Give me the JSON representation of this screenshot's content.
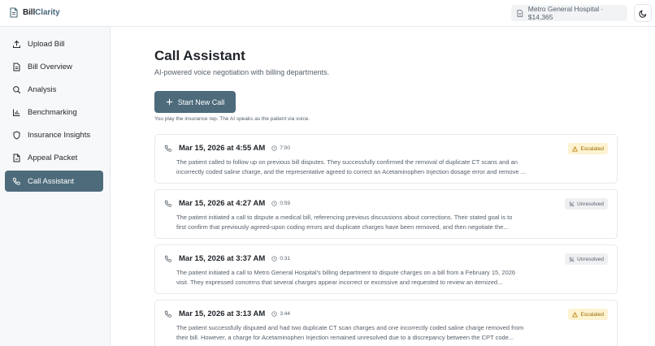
{
  "header": {
    "brand_part1": "Bill",
    "brand_part2": "Clarity",
    "hospital_chip": "Metro General Hospital · $14,365"
  },
  "sidebar": {
    "items": [
      {
        "label": "Upload Bill",
        "icon": "upload-icon",
        "active": false
      },
      {
        "label": "Bill Overview",
        "icon": "document-icon",
        "active": false
      },
      {
        "label": "Analysis",
        "icon": "search-icon",
        "active": false
      },
      {
        "label": "Benchmarking",
        "icon": "bar-chart-icon",
        "active": false
      },
      {
        "label": "Insurance Insights",
        "icon": "shield-icon",
        "active": false
      },
      {
        "label": "Appeal Packet",
        "icon": "file-icon",
        "active": false
      },
      {
        "label": "Call Assistant",
        "icon": "phone-icon",
        "active": true
      }
    ]
  },
  "main": {
    "title": "Call Assistant",
    "subtitle": "AI-powered voice negotiation with billing departments.",
    "start_button": "Start New Call",
    "hint": "You play the insurance rep. The AI speaks as the patient via voice.",
    "calls": [
      {
        "date": "Mar 15, 2026 at 4:55 AM",
        "duration": "7:00",
        "status": "Escalated",
        "summary_line1": "The patient called to follow up on previous bill disputes. They successfully confirmed the removal of duplicate CT scans and an",
        "summary_line2": "incorrectly coded saline charge, and the representative agreed to correct an Acetaminophen Injection dosage error and remove ..."
      },
      {
        "date": "Mar 15, 2026 at 4:27 AM",
        "duration": "0:59",
        "status": "Unresolved",
        "summary_line1": "The patient initiated a call to dispute a medical bill, referencing previous discussions about corrections. Their stated goal is to",
        "summary_line2": "first confirm that previously agreed-upon coding errors and duplicate charges have been removed, and then negotiate the..."
      },
      {
        "date": "Mar 15, 2026 at 3:37 AM",
        "duration": "0:31",
        "status": "Unresolved",
        "summary_line1": "The patient initiated a call to Metro General Hospital's billing department to dispute charges on a bill from a February 15, 2026",
        "summary_line2": "visit. They expressed concerns that several charges appear incorrect or excessive and requested to review an itemized..."
      },
      {
        "date": "Mar 15, 2026 at 3:13 AM",
        "duration": "3:44",
        "status": "Escalated",
        "summary_line1": "The patient successfully disputed and had two duplicate CT scan charges and one incorrectly coded saline charge removed from",
        "summary_line2": "their bill. However, a charge for Acetaminophen Injection remained unresolved due to a discrepancy between the CPT code..."
      }
    ]
  },
  "colors": {
    "accent": "#4d6b7b",
    "escalated_bg": "#fdf3d1",
    "escalated_text": "#9a6b00",
    "unresolved_bg": "#eef0f2"
  }
}
